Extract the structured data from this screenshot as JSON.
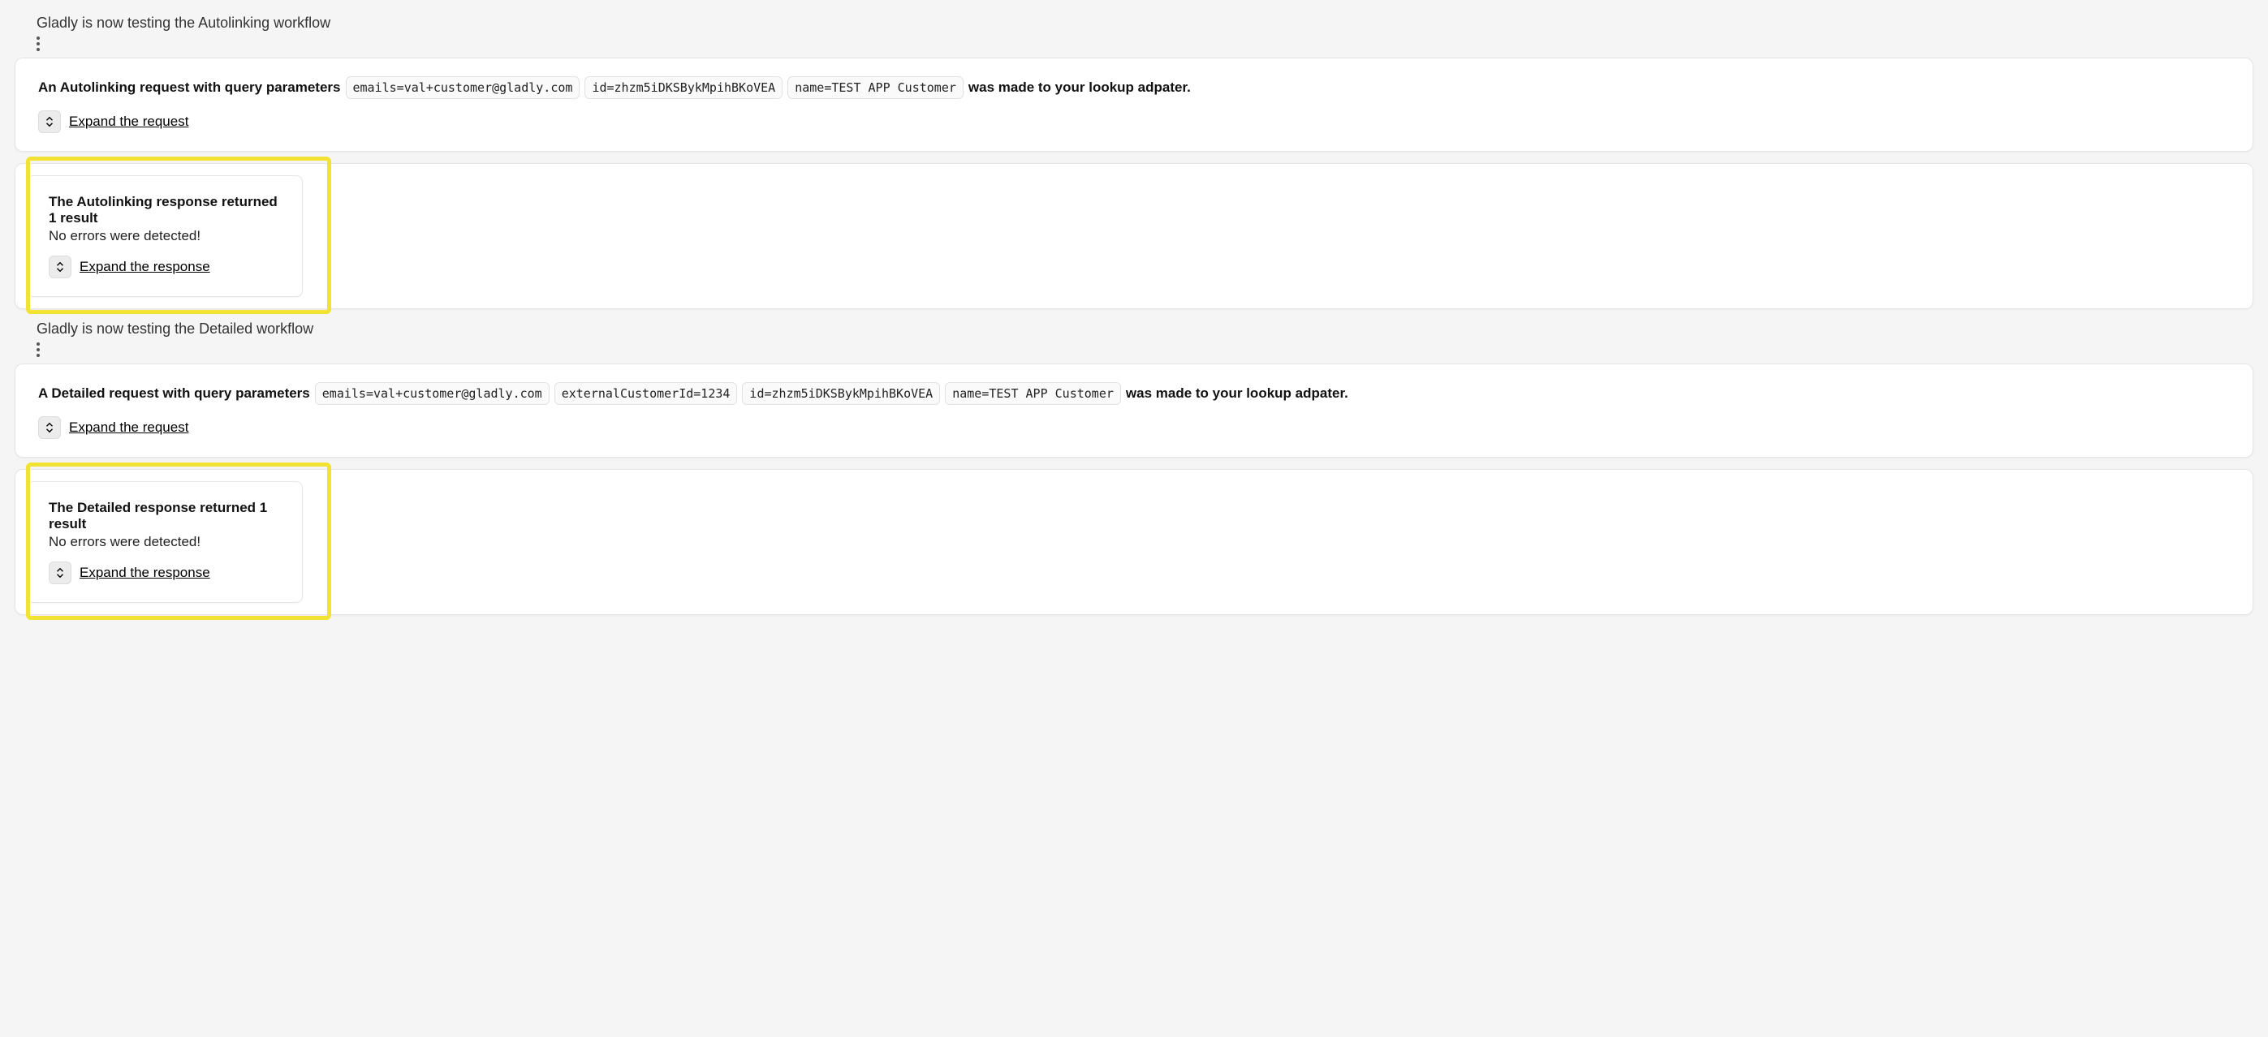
{
  "sections": {
    "autolinking": {
      "heading": "Gladly is now testing the Autolinking workflow",
      "request": {
        "prefix_bold": "An Autolinking request with query parameters",
        "chips": [
          "emails=val+customer@gladly.com",
          "id=zhzm5iDKSBykMpihBKoVEA",
          "name=TEST APP Customer"
        ],
        "suffix_bold": "was made to your lookup adpater.",
        "expand_label": "Expand the request"
      },
      "response": {
        "title_bold": "The Autolinking response returned 1 result",
        "subtext": "No errors were detected!",
        "expand_label": "Expand the response"
      }
    },
    "detailed": {
      "heading": "Gladly is now testing the Detailed workflow",
      "request": {
        "prefix_bold": "A Detailed request with query parameters",
        "chips": [
          "emails=val+customer@gladly.com",
          "externalCustomerId=1234",
          "id=zhzm5iDKSBykMpihBKoVEA",
          "name=TEST APP Customer"
        ],
        "suffix_bold": "was made to your lookup adpater.",
        "expand_label": "Expand the request"
      },
      "response": {
        "title_bold": "The Detailed response returned 1 result",
        "subtext": "No errors were detected!",
        "expand_label": "Expand the response"
      }
    }
  }
}
